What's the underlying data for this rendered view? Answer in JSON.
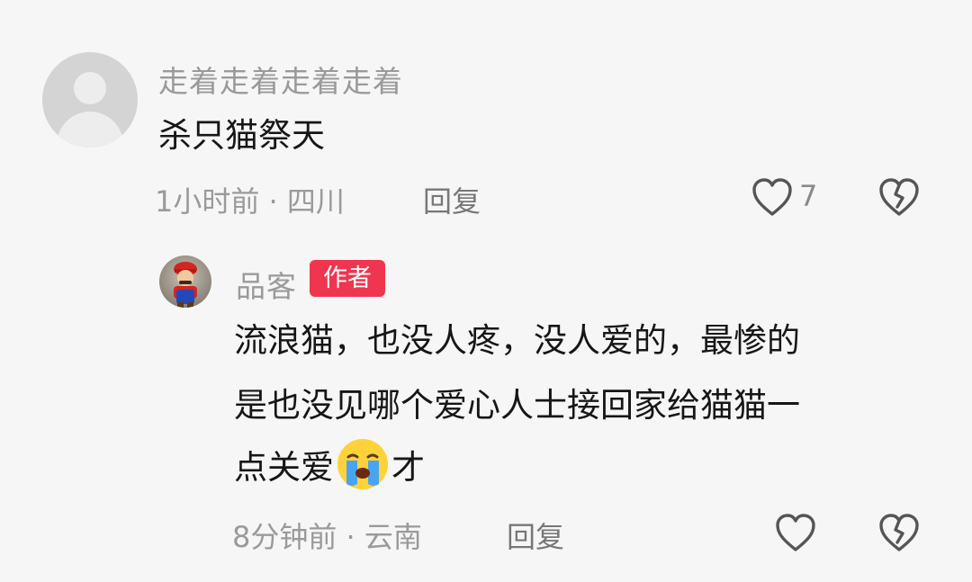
{
  "comments": [
    {
      "username": "走着走着走着走着",
      "text": "杀只猫祭天",
      "time": "1小时前",
      "location": "四川",
      "reply_label": "回复",
      "like_count": "7"
    }
  ],
  "reply": {
    "username": "品客",
    "badge": "作者",
    "text_line1": "流浪猫，也没人疼，没人爱的，最惨的",
    "text_line2": "是也没见哪个爱心人士接回家给猫猫一",
    "text_line3_before": "点关爱",
    "text_line3_after": "才",
    "time": "8分钟前",
    "location": "云南",
    "reply_label": "回复",
    "emoji_name": "crying-face-emoji"
  },
  "separator": " · ",
  "colors": {
    "badge": "#f0354f",
    "text": "#161616",
    "meta": "#9a9a9a"
  }
}
